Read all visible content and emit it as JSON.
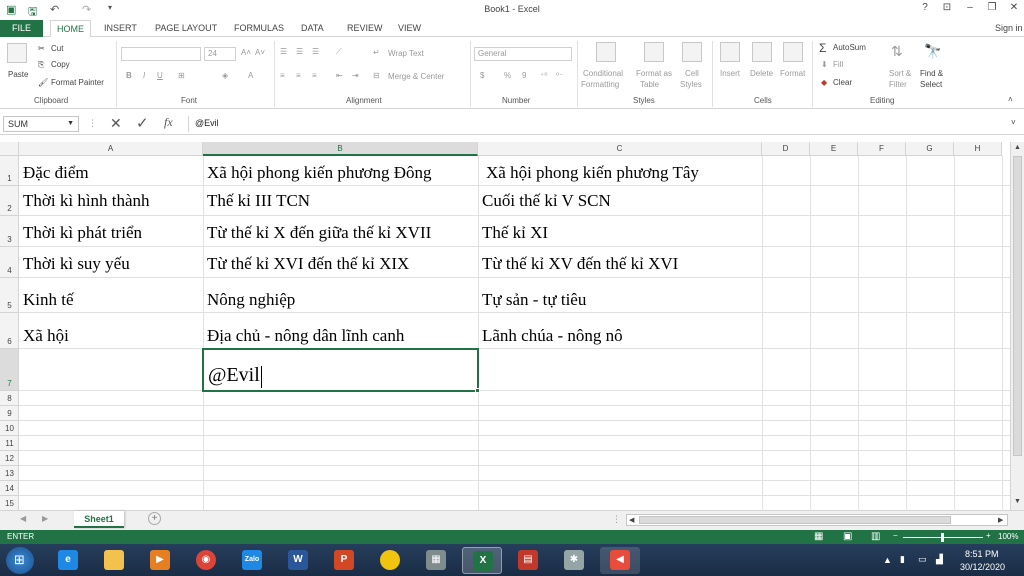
{
  "window": {
    "title": "Book1 - Excel",
    "signin": "Sign in",
    "help": "?"
  },
  "tabs": [
    "FILE",
    "HOME",
    "INSERT",
    "PAGE LAYOUT",
    "FORMULAS",
    "DATA",
    "REVIEW",
    "VIEW"
  ],
  "ribbon": {
    "clipboard": {
      "label": "Clipboard",
      "paste": "Paste",
      "cut": "Cut",
      "copy": "Copy",
      "format_painter": "Format Painter"
    },
    "font": {
      "label": "Font",
      "size": "24"
    },
    "alignment": {
      "label": "Alignment",
      "wrap": "Wrap Text",
      "merge": "Merge & Center"
    },
    "number": {
      "label": "Number",
      "format": "General"
    },
    "styles": {
      "label": "Styles",
      "conditional_1": "Conditional",
      "conditional_2": "Formatting",
      "format_table_1": "Format as",
      "format_table_2": "Table",
      "cell_styles_1": "Cell",
      "cell_styles_2": "Styles"
    },
    "cells": {
      "label": "Cells",
      "insert": "Insert",
      "delete": "Delete",
      "format": "Format"
    },
    "editing": {
      "label": "Editing",
      "autosum": "AutoSum",
      "fill": "Fill",
      "clear": "Clear",
      "sort_1": "Sort &",
      "sort_2": "Filter",
      "find_1": "Find &",
      "find_2": "Select"
    }
  },
  "formula_bar": {
    "name_box": "SUM",
    "fx": "fx",
    "content": "@Evil"
  },
  "columns": [
    "A",
    "B",
    "C",
    "D",
    "E",
    "F",
    "G",
    "H"
  ],
  "rows": [
    "1",
    "2",
    "3",
    "4",
    "5",
    "6",
    "7",
    "8",
    "9",
    "10",
    "11",
    "12",
    "13",
    "14",
    "15"
  ],
  "cells": {
    "r1": [
      "Đặc điểm",
      "Xã hội phong kiến phương Đông",
      "Xã hội phong kiến phương Tây"
    ],
    "r2": [
      "Thời kì hình thành",
      "Thế kỉ III TCN",
      "Cuối thế kỉ V SCN"
    ],
    "r3": [
      "Thời kì phát triển",
      "Từ thế kỉ X đến giữa thế kỉ XVII",
      "Thế kỉ XI"
    ],
    "r4": [
      "Thời kì suy yếu",
      "Từ thế kỉ XVI đến thế kỉ XIX",
      "Từ thế kỉ XV đến thế kỉ XVI"
    ],
    "r5": [
      "Kinh tế",
      "Nông nghiệp",
      "Tự sản - tự tiêu"
    ],
    "r6": [
      "Xã hội",
      "Địa chủ - nông dân lĩnh canh",
      "Lãnh chúa - nông nô"
    ],
    "r7": [
      "",
      "@Evil",
      ""
    ]
  },
  "sheet_tab": "Sheet1",
  "status": {
    "mode": "ENTER",
    "zoom": "100%"
  },
  "taskbar": {
    "time": "8:51 PM",
    "date": "30/12/2020",
    "zalo": "Zalo"
  },
  "colors": {
    "excel_green": "#217346",
    "taskbar": "#1f3450"
  }
}
